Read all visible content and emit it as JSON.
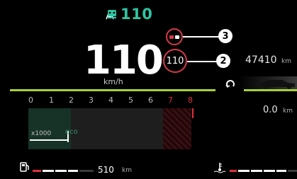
{
  "status": {
    "top_speed": "110",
    "lane_icon": "lane-assist-icon",
    "cruise_icon": "cruise-control-icon",
    "accent": "#2fc6a2"
  },
  "speed": {
    "value": "110",
    "unit": "km/h"
  },
  "speed_limit": {
    "value": "110",
    "ring_color": "#d83a4a",
    "small_icon": "traffic-sign-recognition-icon"
  },
  "callouts": {
    "upper": "3",
    "lower": "2"
  },
  "odometer": {
    "value": "47410",
    "unit": "km"
  },
  "trip": {
    "value": "0.0",
    "unit": "km",
    "reset_icon": "reset-arrow-icon",
    "car_icon": "car-side-icon"
  },
  "rpm": {
    "labels": [
      "0",
      "1",
      "2",
      "3",
      "4",
      "5",
      "6",
      "7",
      "8"
    ],
    "multiplier": "x1000",
    "eco_label": "eco",
    "redline_color": "#e0303c"
  },
  "fuel": {
    "range_value": "510",
    "range_unit": "km",
    "icon": "fuel-pump-icon"
  },
  "coolant": {
    "icon": "coolant-temperature-icon"
  },
  "accent_green": "#a6d13c"
}
